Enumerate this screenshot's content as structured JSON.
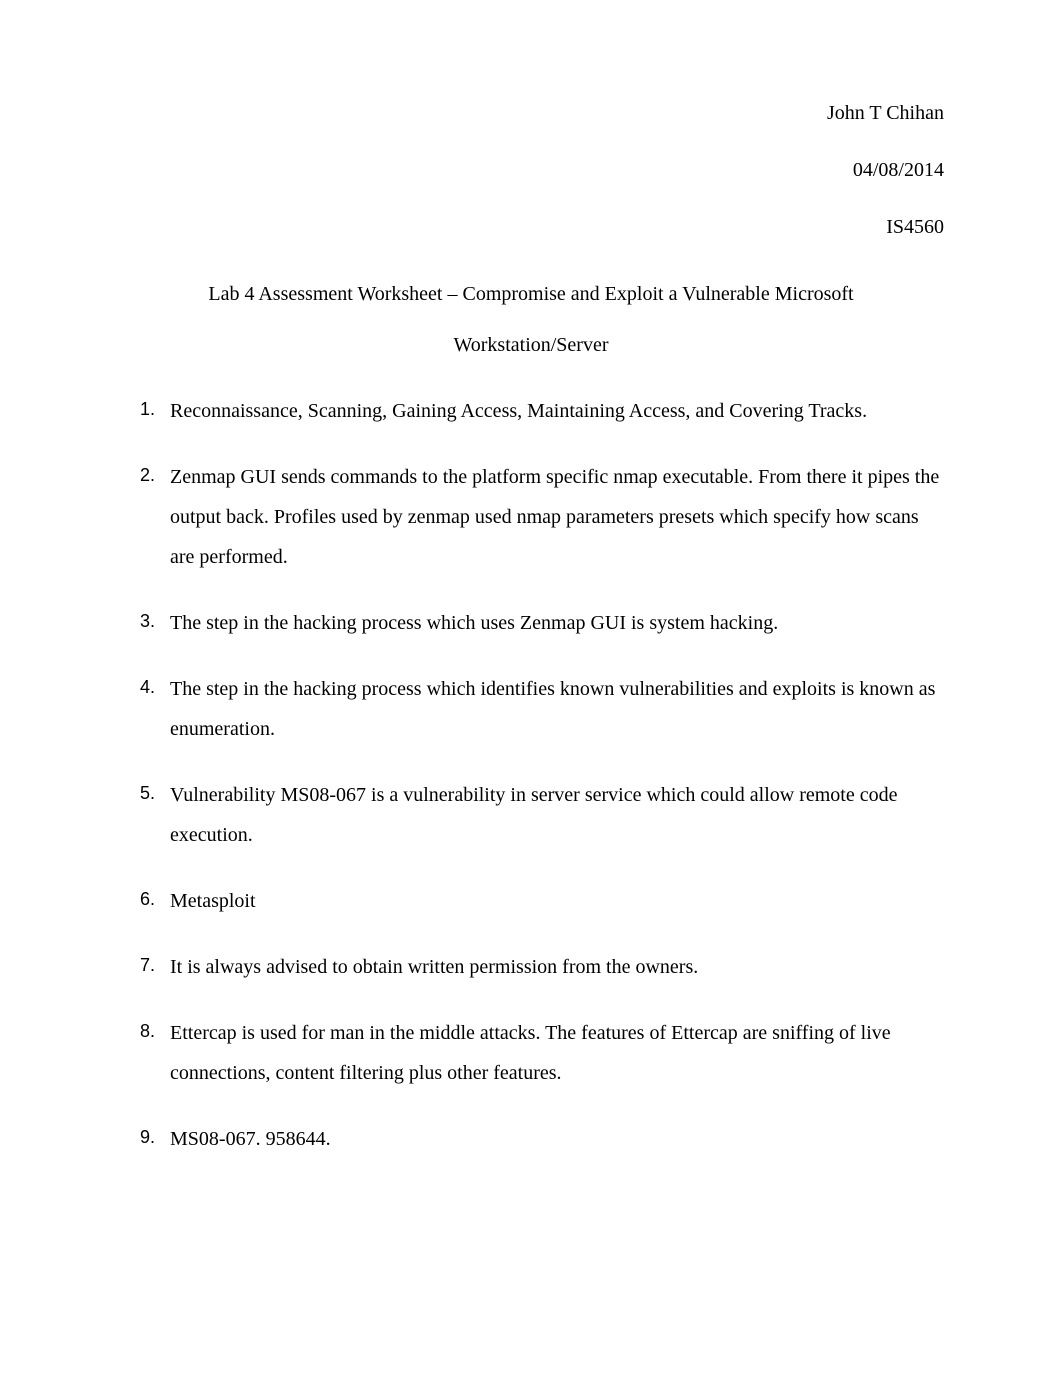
{
  "header": {
    "name": "John T Chihan",
    "date": "04/08/2014",
    "course": "IS4560"
  },
  "title": {
    "line1": "Lab 4 Assessment Worksheet – Compromise and Exploit a Vulnerable Microsoft",
    "line2": "Workstation/Server"
  },
  "items": [
    {
      "num": "1.",
      "text": "Reconnaissance, Scanning, Gaining Access, Maintaining Access, and Covering Tracks."
    },
    {
      "num": "2.",
      "text": "Zenmap GUI sends commands to the platform specific nmap executable. From there it pipes the output back. Profiles used by zenmap used nmap parameters presets which specify how scans are performed."
    },
    {
      "num": "3.",
      "text": "The step in the hacking process which uses Zenmap GUI is system hacking."
    },
    {
      "num": "4.",
      "text": "The step in the hacking process which identifies known vulnerabilities and exploits is known as enumeration."
    },
    {
      "num": "5.",
      "text": "Vulnerability MS08-067 is a vulnerability in server service which could allow remote code execution."
    },
    {
      "num": "6.",
      "text": "Metasploit"
    },
    {
      "num": "7.",
      "text": "It is always advised to obtain written permission from the owners."
    },
    {
      "num": "8.",
      "text": "Ettercap is used for man in the middle attacks. The features of Ettercap are sniffing of live connections, content filtering plus other features."
    },
    {
      "num": "9.",
      "text": "MS08-067. 958644."
    }
  ]
}
